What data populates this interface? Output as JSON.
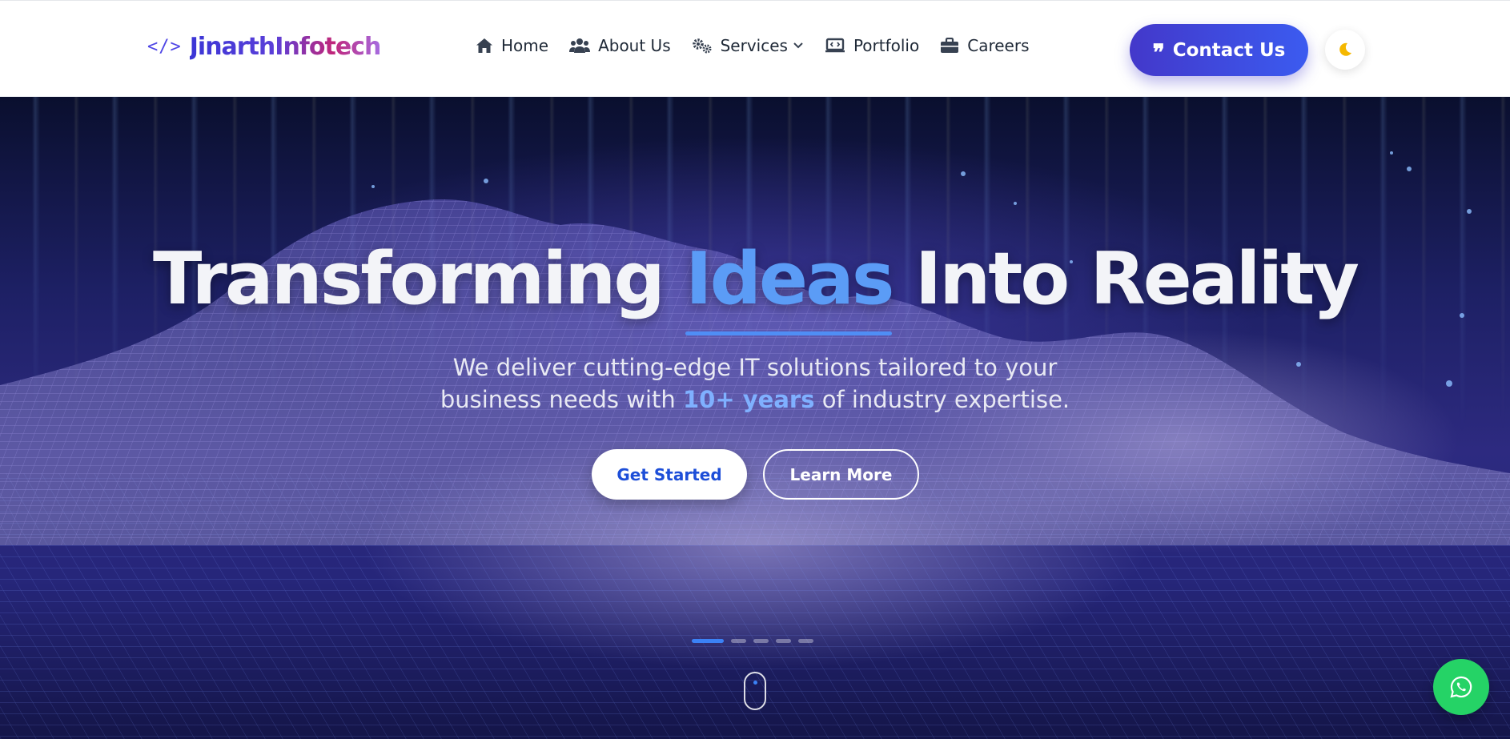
{
  "brand": {
    "code_icon": "</>",
    "name": "JinarthInfotech"
  },
  "nav": {
    "home": "Home",
    "about": "About Us",
    "services": "Services",
    "portfolio": "Portfolio",
    "careers": "Careers"
  },
  "actions": {
    "contact": "Contact Us",
    "theme_toggle_icon": "moon-icon"
  },
  "hero": {
    "title_before": "Transforming",
    "title_highlight": "Ideas",
    "title_after": "Into Reality",
    "subtitle_line1": "We deliver cutting-edge IT solutions tailored to your",
    "subtitle_line2_before": "business needs with",
    "subtitle_accent": "10+ years",
    "subtitle_line2_after": "of industry expertise.",
    "primary_button": "Get Started",
    "secondary_button": "Learn More",
    "slides_total": 5,
    "active_slide": 1
  },
  "colors": {
    "brand": "#4338ca",
    "accent": "#3b82f6",
    "highlight": "#5b9cf6",
    "whatsapp": "#25d366",
    "moon": "#f5b800"
  },
  "floating": {
    "chat_icon": "whatsapp-icon"
  }
}
